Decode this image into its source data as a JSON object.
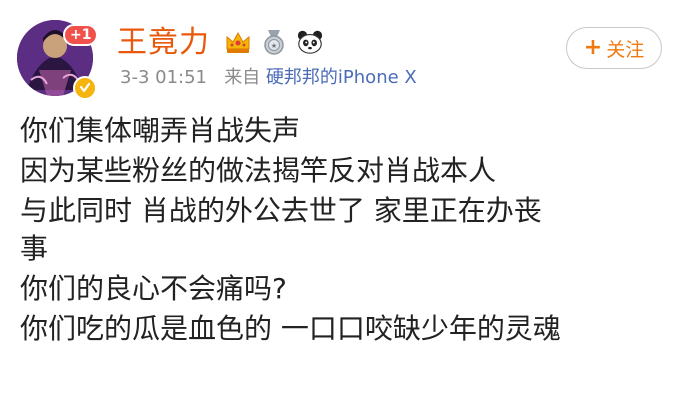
{
  "post": {
    "author": {
      "name": "王竟力",
      "avatar_badge": "+1",
      "icons": [
        "crown-icon",
        "medal-icon",
        "panda-icon"
      ]
    },
    "meta": {
      "time": "3-3 01:51",
      "source_prefix": "来自",
      "source": "硬邦邦的iPhone X"
    },
    "follow_button": {
      "plus": "+",
      "label": "关注"
    },
    "lines": [
      "你们集体嘲弄肖战失声",
      "因为某些粉丝的做法揭竿反对肖战本人",
      "与此同时 肖战的外公去世了 家里正在办丧",
      "事",
      "你们的良心不会痛吗?",
      "你们吃的瓜是血色的 一口口咬缺少年的灵魂"
    ]
  },
  "colors": {
    "username": "#e8590c",
    "follow_accent": "#f07a10",
    "link": "#4b6cb7",
    "meta_gray": "#8a8a8a",
    "badge_red": "#f0524b",
    "verified_gold": "#f5b40f"
  }
}
